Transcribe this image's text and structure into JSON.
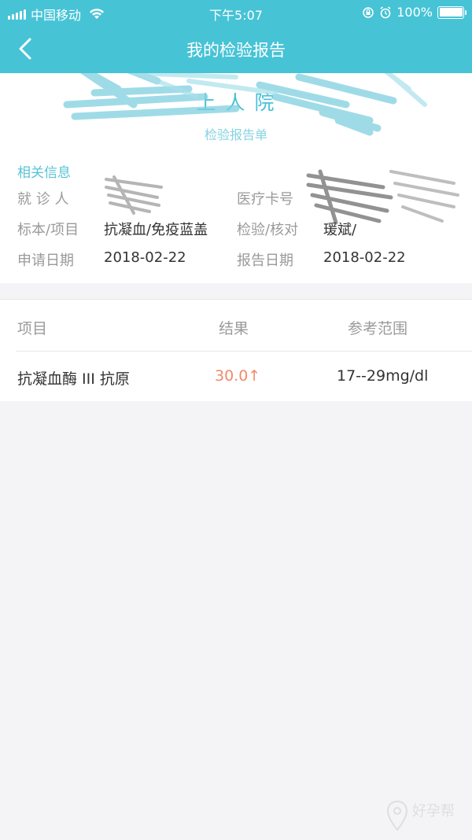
{
  "status_bar": {
    "carrier": "中国移动",
    "time": "下午5:07",
    "battery": "100%"
  },
  "nav": {
    "title": "我的检验报告",
    "back_icon": "chevron-left-icon"
  },
  "report_header": {
    "hospital_name": "上  人    院",
    "subtitle": "检验报告单"
  },
  "info": {
    "section_title": "相关信息",
    "patient_label": "就 诊 人",
    "card_label": "医疗卡号",
    "specimen_label": "标本/项目",
    "specimen_value": "抗凝血/免疫蓝盖",
    "checker_label": "检验/核对",
    "checker_value": "瑗斌/",
    "apply_date_label": "申请日期",
    "apply_date_value": "2018-02-22",
    "report_date_label": "报告日期",
    "report_date_value": "2018-02-22"
  },
  "results": {
    "headers": [
      "项目",
      "结果",
      "参考范围"
    ],
    "rows": [
      {
        "item": "抗凝血酶 III 抗原",
        "result": "30.0↑",
        "range": "17--29mg/dl"
      }
    ]
  },
  "watermark": {
    "text": "好孕帮"
  },
  "colors": {
    "brand_teal": "#47c3d6",
    "label_gray": "#9a9a9a",
    "abnormal": "#f08a6a"
  }
}
